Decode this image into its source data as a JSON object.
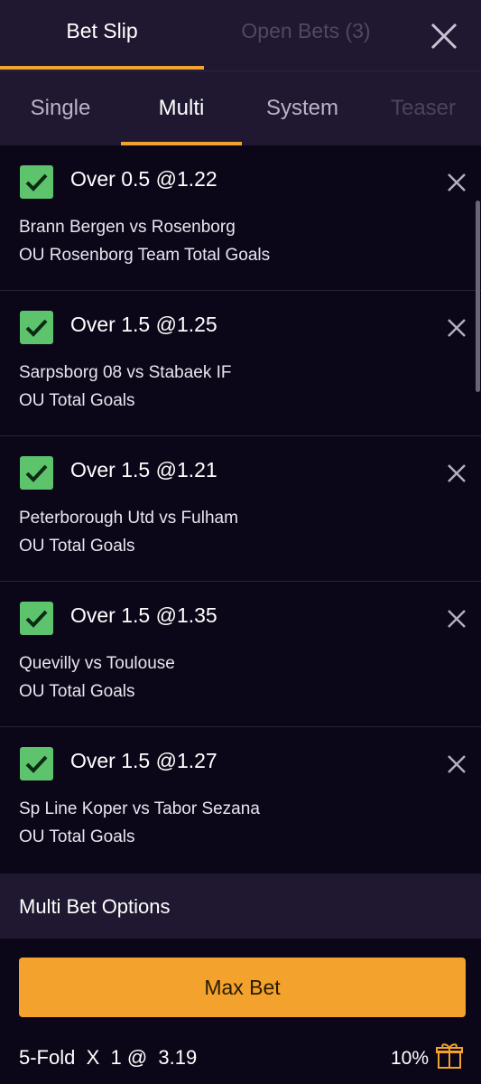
{
  "header": {
    "tabs": [
      "Bet Slip",
      "Open Bets (3)"
    ],
    "active_tab": "Bet Slip"
  },
  "sub_tabs": {
    "items": [
      "Single",
      "Multi",
      "System",
      "Teaser"
    ],
    "active": "Multi"
  },
  "selections": [
    {
      "title": "Over 0.5 @1.22",
      "match": "Brann Bergen vs Rosenborg",
      "market": "OU Rosenborg Team Total Goals"
    },
    {
      "title": "Over 1.5 @1.25",
      "match": "Sarpsborg 08 vs Stabaek IF",
      "market": "OU Total Goals"
    },
    {
      "title": "Over 1.5 @1.21",
      "match": "Peterborough Utd vs Fulham",
      "market": "OU Total Goals"
    },
    {
      "title": "Over 1.5 @1.35",
      "match": "Quevilly vs Toulouse",
      "market": "OU Total Goals"
    },
    {
      "title": "Over 1.5 @1.27",
      "match": "Sp Line Koper vs Tabor Sezana",
      "market": "OU Total Goals"
    }
  ],
  "options": {
    "title": "Multi Bet Options",
    "max_bet_label": "Max Bet",
    "fold_text": "5-Fold  X  1 @  3.19",
    "bonus": "10%"
  },
  "colors": {
    "accent": "#f2a22d",
    "check": "#5dc46d",
    "panel": "#1f1830",
    "background": "#0c0718"
  }
}
